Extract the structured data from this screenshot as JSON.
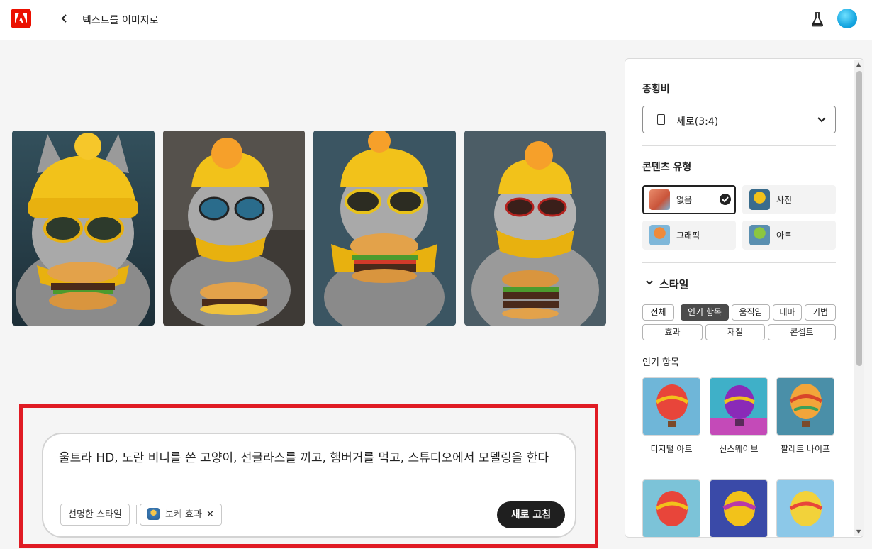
{
  "header": {
    "title": "텍스트를 이미지로"
  },
  "prompt": {
    "text": "울트라 HD, 노란 비니를 쓴 고양이, 선글라스를 끼고, 햄버거를 먹고, 스튜디오에서 모델링을 한다",
    "chips": [
      "선명한 스타일",
      "보케 효과"
    ],
    "refresh_label": "새로 고침"
  },
  "panel": {
    "aspect": {
      "title": "종횡비",
      "value": "세로(3:4)"
    },
    "content_type": {
      "title": "콘텐츠 유형",
      "options": [
        {
          "label": "없음",
          "selected": true
        },
        {
          "label": "사진",
          "selected": false
        },
        {
          "label": "그래픽",
          "selected": false
        },
        {
          "label": "아트",
          "selected": false
        }
      ]
    },
    "style": {
      "title": "스타일",
      "tags": [
        "전체",
        "인기 항목",
        "움직임",
        "테마",
        "기법",
        "효과",
        "재질",
        "콘셉트"
      ],
      "active_tag": "인기 항목",
      "popular_title": "인기 항목",
      "popular_items": [
        "디지털 아트",
        "신스웨이브",
        "팔레트 나이프"
      ]
    }
  },
  "colors": {
    "accent": "#eb1000",
    "highlight": "#e01b24",
    "button": "#1f1f1f"
  }
}
